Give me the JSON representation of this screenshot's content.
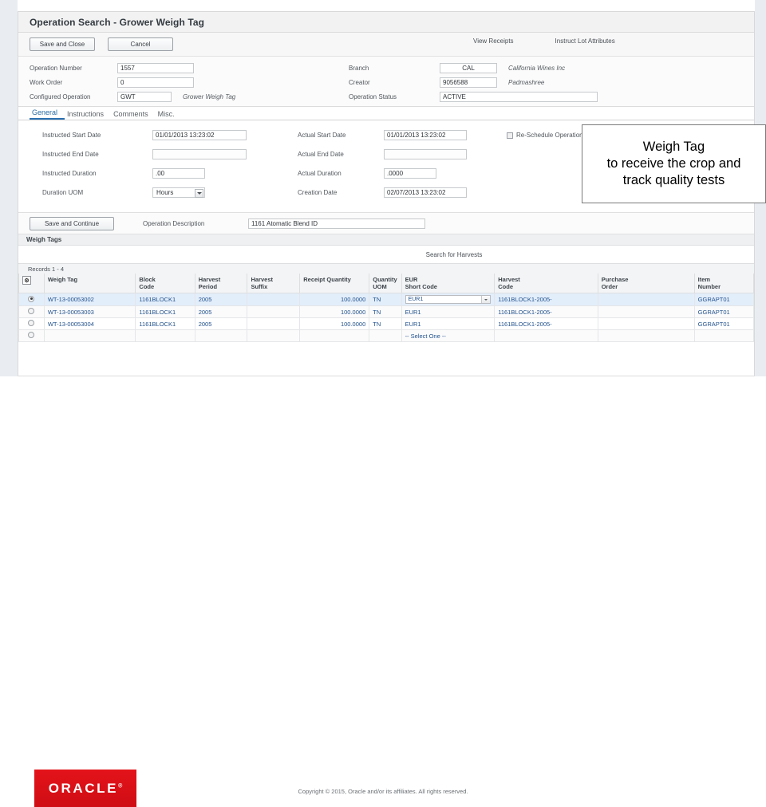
{
  "window": {
    "title": "Operation Search - Grower Weigh Tag"
  },
  "toolbar": {
    "save_and_close_label": "Save and Close",
    "cancel_label": "Cancel",
    "view_receipts_label": "View Receipts",
    "instruct_lot_attributes_label": "Instruct Lot Attributes"
  },
  "header_fields": {
    "operation_number_label": "Operation Number",
    "operation_number_value": "1557",
    "work_order_label": "Work Order",
    "work_order_value": "0",
    "configured_operation_label": "Configured Operation",
    "configured_operation_value": "GWT",
    "configured_operation_note": "Grower Weigh Tag",
    "branch_label": "Branch",
    "branch_value": "CAL",
    "branch_note": "California Wines Inc",
    "creator_label": "Creator",
    "creator_value": "9056588",
    "creator_note": "Padmashree",
    "operation_status_label": "Operation Status",
    "operation_status_value": "ACTIVE"
  },
  "tabs": [
    {
      "label": "General",
      "active": true
    },
    {
      "label": "Instructions",
      "active": false
    },
    {
      "label": "Comments",
      "active": false
    },
    {
      "label": "Misc.",
      "active": false
    }
  ],
  "general_tab": {
    "instructed_start_date_label": "Instructed Start Date",
    "instructed_start_date_value": "01/01/2013 13:23:02",
    "instructed_end_date_label": "Instructed End Date",
    "instructed_end_date_value": "",
    "instructed_duration_label": "Instructed Duration",
    "instructed_duration_value": ".00",
    "duration_uom_label": "Duration UOM",
    "duration_uom_value": "Hours",
    "actual_start_date_label": "Actual Start Date",
    "actual_start_date_value": "01/01/2013 13:23:02",
    "actual_end_date_label": "Actual End Date",
    "actual_end_date_value": "",
    "actual_duration_label": "Actual Duration",
    "actual_duration_value": ".0000",
    "creation_date_label": "Creation Date",
    "creation_date_value": "02/07/2013 13:23:02",
    "reschedule_checkbox_label": "Re-Schedule Operations",
    "reschedule_checked": false
  },
  "continue_row": {
    "save_and_continue_label": "Save and Continue",
    "operation_description_label": "Operation Description",
    "operation_description_value": "1161 Atomatic Blend ID"
  },
  "weigh_tags_section": {
    "section_title": "Weigh Tags",
    "search_for_harvests_label": "Search for Harvests",
    "records_text": "Records 1 - 4",
    "columns": [
      "",
      "Weigh Tag",
      "Block\nCode",
      "Harvest\nPeriod",
      "Harvest\nSuffix",
      "Receipt Quantity",
      "Quantity\nUOM",
      "EUR\nShort Code",
      "Harvest\nCode",
      "Purchase\nOrder",
      "Item\nNumber"
    ],
    "column_labels": {
      "weigh_tag": "Weigh Tag",
      "block_code_line1": "Block",
      "block_code_line2": "Code",
      "harvest_period_line1": "Harvest",
      "harvest_period_line2": "Period",
      "harvest_suffix_line1": "Harvest",
      "harvest_suffix_line2": "Suffix",
      "receipt_quantity": "Receipt Quantity",
      "quantity_uom_line1": "Quantity",
      "quantity_uom_line2": "UOM",
      "eur_short_code_line1": "EUR",
      "eur_short_code_line2": "Short Code",
      "harvest_code_line1": "Harvest",
      "harvest_code_line2": "Code",
      "purchase_order_line1": "Purchase",
      "purchase_order_line2": "Order",
      "item_number_line1": "Item",
      "item_number_line2": "Number"
    },
    "rows": [
      {
        "selected": true,
        "weigh_tag": "WT-13-00053002",
        "block_code": "1161BLOCK1",
        "harvest_period": "2005",
        "harvest_suffix": "",
        "receipt_quantity": "100.0000",
        "quantity_uom": "TN",
        "eur_short_code": "EUR1",
        "eur_is_dropdown": true,
        "harvest_code": "1161BLOCK1-2005-",
        "purchase_order": "",
        "item_number": "GGRAPT01"
      },
      {
        "selected": false,
        "weigh_tag": "WT-13-00053003",
        "block_code": "1161BLOCK1",
        "harvest_period": "2005",
        "harvest_suffix": "",
        "receipt_quantity": "100.0000",
        "quantity_uom": "TN",
        "eur_short_code": "EUR1",
        "eur_is_dropdown": false,
        "harvest_code": "1161BLOCK1-2005-",
        "purchase_order": "",
        "item_number": "GGRAPT01"
      },
      {
        "selected": false,
        "weigh_tag": "WT-13-00053004",
        "block_code": "1161BLOCK1",
        "harvest_period": "2005",
        "harvest_suffix": "",
        "receipt_quantity": "100.0000",
        "quantity_uom": "TN",
        "eur_short_code": "EUR1",
        "eur_is_dropdown": false,
        "harvest_code": "1161BLOCK1-2005-",
        "purchase_order": "",
        "item_number": "GGRAPT01"
      },
      {
        "selected": false,
        "weigh_tag": "",
        "block_code": "",
        "harvest_period": "",
        "harvest_suffix": "",
        "receipt_quantity": "",
        "quantity_uom": "",
        "eur_short_code": "-- Select One --",
        "eur_is_dropdown": false,
        "harvest_code": "",
        "purchase_order": "",
        "item_number": ""
      }
    ]
  },
  "callout": {
    "line1": "Weigh Tag",
    "line2": "to receive the crop and",
    "line3": "track quality tests"
  },
  "footer": {
    "logo_text": "ORACLE",
    "logo_mark": "®",
    "copyright": "Copyright © 2015, Oracle and/or its affiliates. All rights reserved."
  },
  "colors": {
    "brand_red": "#e8121a",
    "accent_blue": "#2a6fb0",
    "selected_row": "#e3eefb",
    "link_text": "#22528c"
  }
}
